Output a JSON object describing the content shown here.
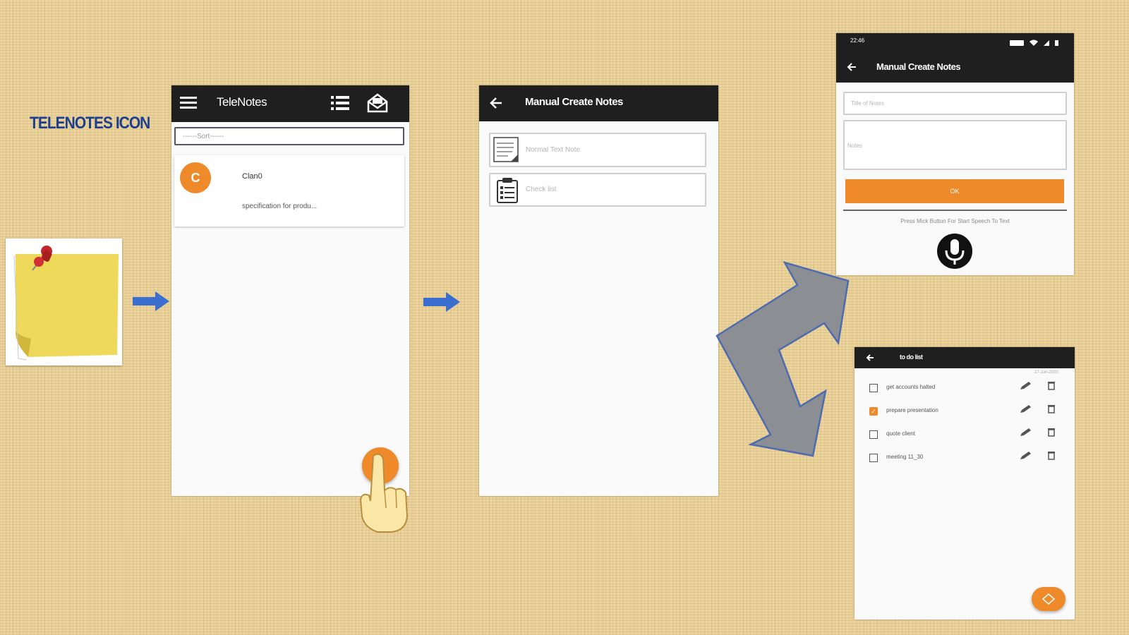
{
  "label": "TELENOTES ICON",
  "icons": {
    "app_icon": "sticky-note-pin-icon",
    "arrow": "right-arrow-icon",
    "split_arrow": "split-arrow-icon",
    "hand": "pointing-hand-icon"
  },
  "colors": {
    "accent": "#ef8a2b",
    "appbar": "#1f1f1f",
    "label": "#1d3f8f",
    "arrow": "#3a6fd0"
  },
  "screen1": {
    "title": "TeleNotes",
    "search_placeholder": "------Sort------",
    "note": {
      "avatar_letter": "C",
      "title": "Clan0",
      "subtitle": "specification for produ..."
    }
  },
  "screen2": {
    "title": "Manual Create Notes",
    "options": [
      {
        "label": "Normal Text Note",
        "icon": "text-note-icon"
      },
      {
        "label": "Check list",
        "icon": "clipboard-list-icon"
      }
    ]
  },
  "screen3": {
    "status_time": "22:46",
    "title": "Manual Create Notes",
    "title_placeholder": "Title of Notes",
    "notes_placeholder": "Notes",
    "ok_label": "OK",
    "speech_hint": "Press Mick Button For Start Speech To Text"
  },
  "screen4": {
    "title": "to do list",
    "date": "27-Jun-2020",
    "items": [
      {
        "text": "get accounts halted",
        "checked": false
      },
      {
        "text": "prepare presentation",
        "checked": true
      },
      {
        "text": "quote client",
        "checked": false
      },
      {
        "text": "meeting 11_30",
        "checked": false
      }
    ]
  }
}
